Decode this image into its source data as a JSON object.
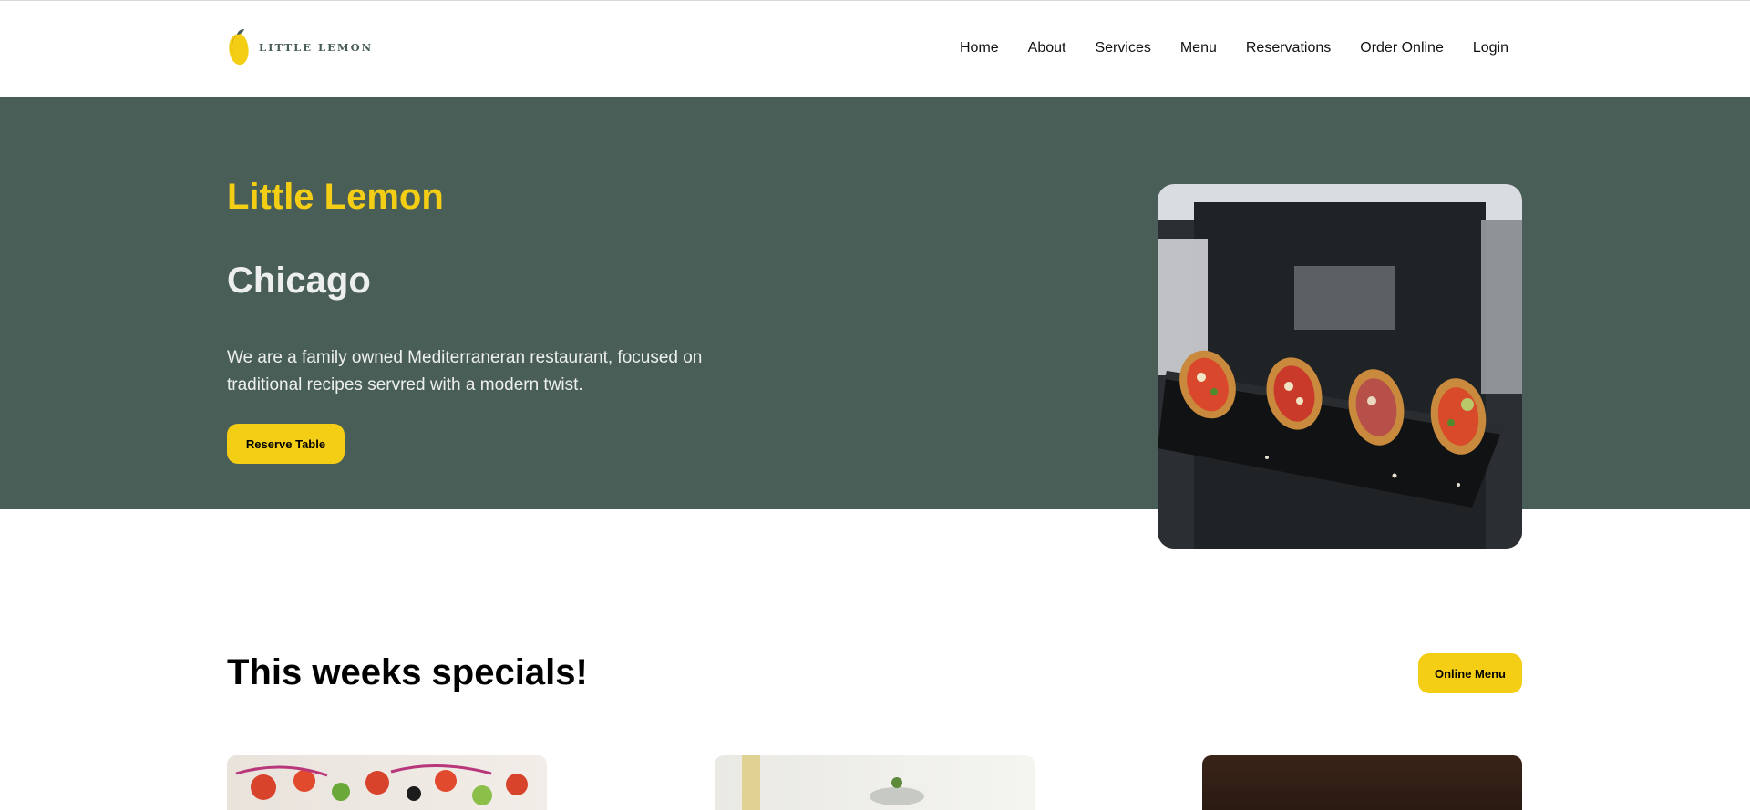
{
  "brand": {
    "name": "LITTLE LEMON",
    "accent_color": "#f4ce14",
    "primary_color": "#495e57"
  },
  "nav": {
    "items": [
      {
        "label": "Home"
      },
      {
        "label": "About"
      },
      {
        "label": "Services"
      },
      {
        "label": "Menu"
      },
      {
        "label": "Reservations"
      },
      {
        "label": "Order Online"
      },
      {
        "label": "Login"
      }
    ]
  },
  "hero": {
    "title": "Little Lemon",
    "subtitle": "Chicago",
    "description": "We are a family owned Mediterraneran restaurant, focused on traditional recipes servred with a modern twist.",
    "cta_label": "Reserve Table",
    "image_alt": "Chef holding slate board of bruschetta"
  },
  "specials": {
    "title": "This weeks specials!",
    "cta_label": "Online Menu"
  }
}
